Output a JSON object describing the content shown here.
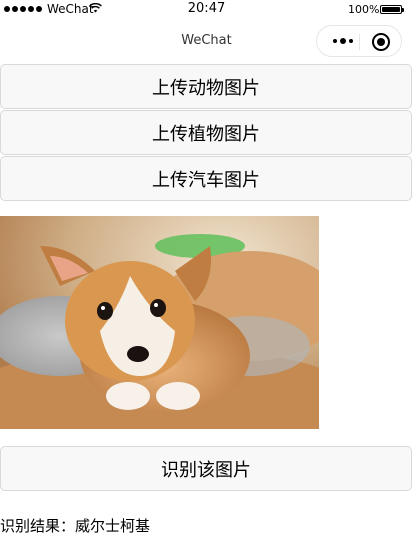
{
  "status_bar": {
    "carrier": "WeChat",
    "time": "20:47",
    "battery": "100%"
  },
  "nav": {
    "title": "WeChat",
    "more_icon": "more-dots-icon",
    "close_icon": "target-circle-icon"
  },
  "buttons": {
    "upload_animal": "上传动物图片",
    "upload_plant": "上传植物图片",
    "upload_car": "上传汽车图片",
    "identify": "识别该图片"
  },
  "photo": {
    "subject": "corgi puppy"
  },
  "result": {
    "text": "识别结果：威尔士柯基"
  }
}
